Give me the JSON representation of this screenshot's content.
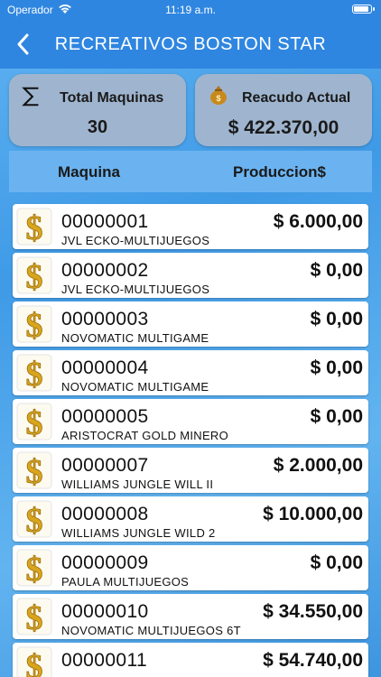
{
  "status": {
    "carrier": "Operador",
    "time": "11:19 a.m."
  },
  "nav": {
    "title": "RECREATIVOS BOSTON STAR"
  },
  "summary": {
    "total_label": "Total Maquinas",
    "total_value": "30",
    "reaudo_label": "Reacudo Actual",
    "reaudo_value": "$ 422.370,00"
  },
  "table": {
    "col_machine": "Maquina",
    "col_production": "Produccion$",
    "rows": [
      {
        "id": "00000001",
        "name": "JVL ECKO-MULTIJUEGOS",
        "amount": "$ 6.000,00"
      },
      {
        "id": "00000002",
        "name": "JVL ECKO-MULTIJUEGOS",
        "amount": "$ 0,00"
      },
      {
        "id": "00000003",
        "name": "NOVOMATIC MULTIGAME",
        "amount": "$ 0,00"
      },
      {
        "id": "00000004",
        "name": "NOVOMATIC MULTIGAME",
        "amount": "$ 0,00"
      },
      {
        "id": "00000005",
        "name": "ARISTOCRAT GOLD MINERO",
        "amount": "$ 0,00"
      },
      {
        "id": "00000007",
        "name": "WILLIAMS JUNGLE WILL II",
        "amount": "$ 2.000,00"
      },
      {
        "id": "00000008",
        "name": "WILLIAMS JUNGLE WILD 2",
        "amount": "$ 10.000,00"
      },
      {
        "id": "00000009",
        "name": "PAULA MULTIJUEGOS",
        "amount": "$ 0,00"
      },
      {
        "id": "00000010",
        "name": "NOVOMATIC MULTIJUEGOS 6T",
        "amount": "$ 34.550,00"
      },
      {
        "id": "00000011",
        "name": "",
        "amount": "$ 54.740,00"
      }
    ]
  },
  "icons": {
    "back": "chevron-left-icon",
    "sum": "sigma-icon",
    "money": "money-bag-icon",
    "row": "dollar-sign-icon"
  },
  "colors": {
    "nav": "#2f86e0",
    "card": "#9fb5cf",
    "header": "#6bb3f0",
    "dollar": "#d9a51c"
  }
}
